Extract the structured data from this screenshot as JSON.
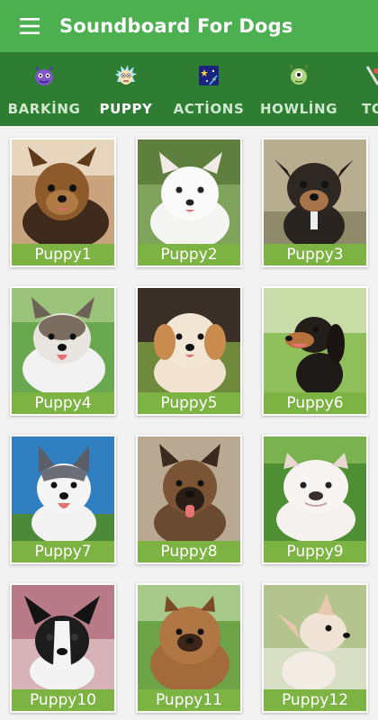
{
  "appbar": {
    "title": "Soundboard For Dogs",
    "menu_icon": "hamburger-menu-icon"
  },
  "tabs": [
    {
      "label": "BARKİNG",
      "icon": "monster-icon",
      "active": false
    },
    {
      "label": "PUPPY",
      "icon": "rick-face-icon",
      "active": true
    },
    {
      "label": "ACTİONS",
      "icon": "stars-picture-icon",
      "active": false
    },
    {
      "label": "HOWLİNG",
      "icon": "alien-icon",
      "active": false
    },
    {
      "label": "TO",
      "icon": "partial-tab-icon",
      "active": false
    }
  ],
  "cards": [
    {
      "label": "Puppy1",
      "image": "yorkshire-terrier-puppy-photo"
    },
    {
      "label": "Puppy2",
      "image": "white-fluffy-puppy-photo"
    },
    {
      "label": "Puppy3",
      "image": "black-brown-puppy-photo"
    },
    {
      "label": "Puppy4",
      "image": "husky-mix-puppy-on-grass-photo"
    },
    {
      "label": "Puppy5",
      "image": "cavapoo-puppy-photo"
    },
    {
      "label": "Puppy6",
      "image": "dachshund-puppy-photo"
    },
    {
      "label": "Puppy7",
      "image": "husky-puppy-blue-sky-photo"
    },
    {
      "label": "Puppy8",
      "image": "german-shepherd-puppy-photo"
    },
    {
      "label": "Puppy9",
      "image": "white-bulldog-puppy-photo"
    },
    {
      "label": "Puppy10",
      "image": "french-bulldog-puppy-photo"
    },
    {
      "label": "Puppy11",
      "image": "pomeranian-puppy-photo"
    },
    {
      "label": "Puppy12",
      "image": "chihuahua-puppy-photo"
    }
  ],
  "colors": {
    "appbar": "#4caf50",
    "tabbar": "#2e7d32",
    "label_bg": "#7cb342",
    "background": "#f2f2f2"
  }
}
